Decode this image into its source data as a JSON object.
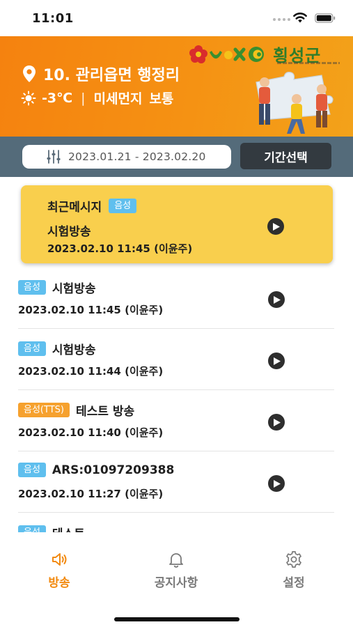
{
  "status_bar": {
    "time": "11:01"
  },
  "banner": {
    "location": "10. 관리읍면 행정리",
    "temperature": "-3℃",
    "separator": "|",
    "dust_label": "미세먼지",
    "dust_value": "보통",
    "logo_text": "횡성군",
    "colors": {
      "background": "#f5820f",
      "logo_green": "#2f7d2b"
    }
  },
  "filter": {
    "date_range": "2023.01.21 - 2023.02.20",
    "period_button_label": "기간선택"
  },
  "recent": {
    "title": "최근메시지",
    "badge": "음성",
    "message": "시험방송",
    "date": "2023.02.10 11:45 (이윤주)"
  },
  "messages": [
    {
      "badge": "음성",
      "badge_type": "voice",
      "title": "시험방송",
      "date": "2023.02.10 11:45 (이윤주)"
    },
    {
      "badge": "음성",
      "badge_type": "voice",
      "title": "시험방송",
      "date": "2023.02.10 11:44 (이윤주)"
    },
    {
      "badge": "음성(TTS)",
      "badge_type": "tts",
      "title": "테스트 방송",
      "date": "2023.02.10 11:40 (이윤주)"
    },
    {
      "badge": "음성",
      "badge_type": "voice",
      "title": "ARS:01097209388",
      "date": "2023.02.10 11:27 (이윤주)"
    },
    {
      "badge": "음성",
      "badge_type": "voice",
      "title": "테스트",
      "date": ""
    }
  ],
  "tabs": [
    {
      "label": "방송",
      "icon": "speaker-icon",
      "active": true
    },
    {
      "label": "공지사항",
      "icon": "bell-icon",
      "active": false
    },
    {
      "label": "설정",
      "icon": "gear-icon",
      "active": false
    }
  ],
  "colors": {
    "accent": "#f28a10",
    "recent_card": "#f9cf4d",
    "voice_badge": "#5fbfee",
    "tts_badge": "#f6a12e",
    "filter_bar": "#546b7a"
  }
}
